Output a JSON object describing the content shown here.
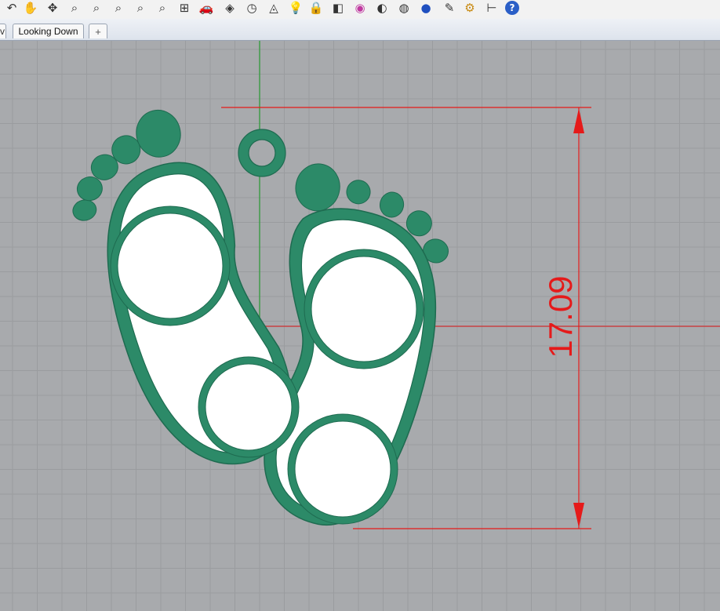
{
  "toolbar": {
    "icons": [
      {
        "name": "undo-view-icon",
        "glyph": "↶"
      },
      {
        "name": "pan-hand-icon",
        "glyph": "✋"
      },
      {
        "name": "rotate-view-icon",
        "glyph": "✥"
      },
      {
        "name": "zoom-dynamic-icon",
        "glyph": "⌕"
      },
      {
        "name": "zoom-window-icon",
        "glyph": "⌕"
      },
      {
        "name": "zoom-extents-icon",
        "glyph": "⌕"
      },
      {
        "name": "zoom-selected-icon",
        "glyph": "⌕"
      },
      {
        "name": "zoom-all-icon",
        "glyph": "⌕"
      },
      {
        "name": "four-viewports-icon",
        "glyph": "⊞"
      },
      {
        "name": "car-icon",
        "glyph": "🚗"
      },
      {
        "name": "set-view-icon",
        "glyph": "◈"
      },
      {
        "name": "clock-icon",
        "glyph": "◷"
      },
      {
        "name": "shapes-icon",
        "glyph": "◬"
      },
      {
        "name": "light-bulb-icon",
        "glyph": "💡"
      },
      {
        "name": "lock-icon",
        "glyph": "🔒"
      },
      {
        "name": "layers-icon",
        "glyph": "◧"
      },
      {
        "name": "color-wheel-icon",
        "glyph": "◉"
      },
      {
        "name": "shaded-sphere-icon",
        "glyph": "◐"
      },
      {
        "name": "ghosted-sphere-icon",
        "glyph": "◍"
      },
      {
        "name": "rendered-sphere-icon",
        "glyph": "●"
      },
      {
        "name": "pencil-icon",
        "glyph": "✎"
      },
      {
        "name": "settings-gear-icon",
        "glyph": "⚙"
      },
      {
        "name": "grid-snap-icon",
        "glyph": "⊢"
      },
      {
        "name": "help-icon",
        "glyph": "?"
      }
    ]
  },
  "tabs": {
    "partial_label": "v",
    "active_label": "Looking Down",
    "add_label": "+"
  },
  "viewport": {
    "dimension_label": "17.09",
    "colors": {
      "background": "#a8aaad",
      "grid": "#9a9c9f",
      "y_axis": "#2f9a3a",
      "x_axis": "#cf2f2f",
      "dimension": "#e51a1a",
      "model_green": "#2c8a68",
      "model_inner": "#ffffff"
    }
  }
}
